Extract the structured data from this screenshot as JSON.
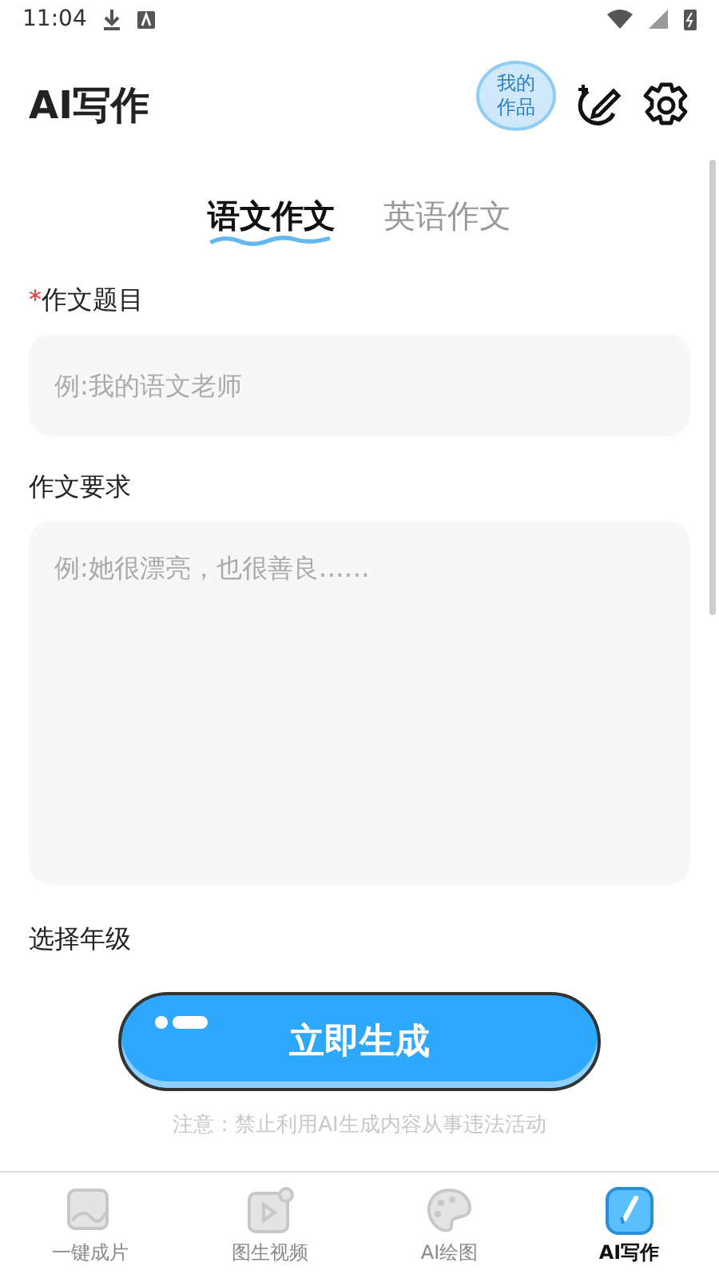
{
  "status_bar": {
    "time": "11:04"
  },
  "header": {
    "title": "AI写作",
    "works_badge": "我的作品"
  },
  "tabs": [
    {
      "label": "语文作文",
      "selected": true
    },
    {
      "label": "英语作文",
      "selected": false
    }
  ],
  "form": {
    "title_label_mark": "*",
    "title_label": "作文题目",
    "title_field": {
      "placeholder": "例:我的语文老师"
    },
    "requirement_label": "作文要求",
    "requirement_field": {
      "placeholder": "例:她很漂亮，也很善良……"
    },
    "grade_label": "选择年级"
  },
  "generate_button": "立即生成",
  "notice": "注意：禁止利用AI生成内容从事违法活动",
  "bottom_nav": [
    {
      "label": "一键成片",
      "selected": false,
      "kind": "photo"
    },
    {
      "label": "图生视频",
      "selected": false,
      "kind": "video"
    },
    {
      "label": "AI绘图",
      "selected": false,
      "kind": "palette"
    },
    {
      "label": "AI写作",
      "selected": true,
      "kind": "pen"
    }
  ]
}
